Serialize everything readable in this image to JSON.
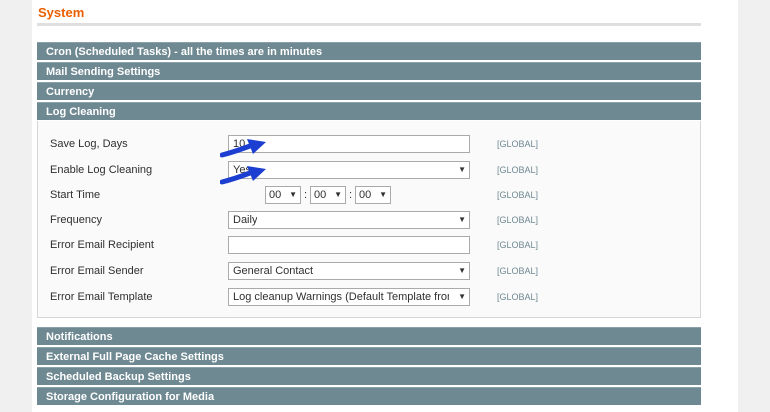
{
  "page": {
    "title": "System"
  },
  "sections_top": [
    {
      "label": "Cron (Scheduled Tasks) - all the times are in minutes"
    },
    {
      "label": "Mail Sending Settings"
    },
    {
      "label": "Currency"
    },
    {
      "label": "Log Cleaning"
    }
  ],
  "log_cleaning": {
    "save_log_days": {
      "label": "Save Log, Days",
      "value": "10",
      "scope": "[GLOBAL]"
    },
    "enable_log_cleaning": {
      "label": "Enable Log Cleaning",
      "value": "Yes",
      "scope": "[GLOBAL]"
    },
    "start_time": {
      "label": "Start Time",
      "hour": "00",
      "minute": "00",
      "second": "00",
      "separator": ":",
      "scope": "[GLOBAL]"
    },
    "frequency": {
      "label": "Frequency",
      "value": "Daily",
      "scope": "[GLOBAL]"
    },
    "error_email_recipient": {
      "label": "Error Email Recipient",
      "value": "",
      "scope": "[GLOBAL]"
    },
    "error_email_sender": {
      "label": "Error Email Sender",
      "value": "General Contact",
      "scope": "[GLOBAL]"
    },
    "error_email_template": {
      "label": "Error Email Template",
      "value": "Log cleanup Warnings (Default Template from",
      "scope": "[GLOBAL]"
    }
  },
  "sections_bottom": [
    {
      "label": "Notifications"
    },
    {
      "label": "External Full Page Cache Settings"
    },
    {
      "label": "Scheduled Backup Settings"
    },
    {
      "label": "Storage Configuration for Media"
    }
  ],
  "icons": {
    "dropdown": "▼",
    "pointer": "blue-arrow-icon"
  },
  "colors": {
    "accent": "#eb5e00",
    "section_header": "#6f8992",
    "pointer": "#1c3fd1"
  }
}
